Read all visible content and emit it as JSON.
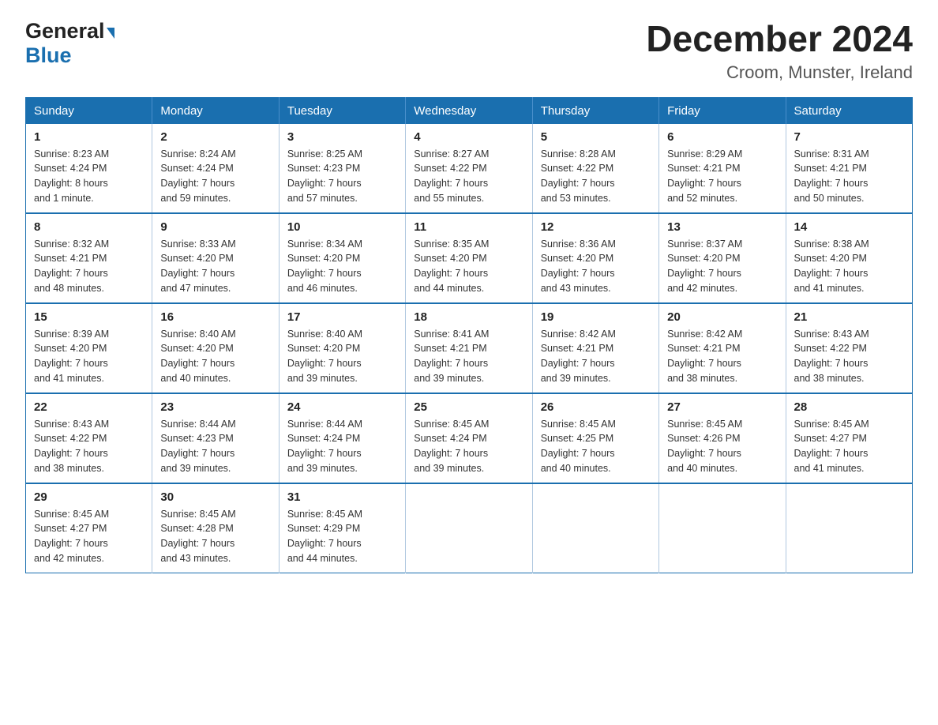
{
  "header": {
    "logo_general": "General",
    "logo_blue": "Blue",
    "title": "December 2024",
    "subtitle": "Croom, Munster, Ireland"
  },
  "days_of_week": [
    "Sunday",
    "Monday",
    "Tuesday",
    "Wednesday",
    "Thursday",
    "Friday",
    "Saturday"
  ],
  "weeks": [
    [
      {
        "day": "1",
        "sunrise": "8:23 AM",
        "sunset": "4:24 PM",
        "daylight": "8 hours and 1 minute."
      },
      {
        "day": "2",
        "sunrise": "8:24 AM",
        "sunset": "4:24 PM",
        "daylight": "7 hours and 59 minutes."
      },
      {
        "day": "3",
        "sunrise": "8:25 AM",
        "sunset": "4:23 PM",
        "daylight": "7 hours and 57 minutes."
      },
      {
        "day": "4",
        "sunrise": "8:27 AM",
        "sunset": "4:22 PM",
        "daylight": "7 hours and 55 minutes."
      },
      {
        "day": "5",
        "sunrise": "8:28 AM",
        "sunset": "4:22 PM",
        "daylight": "7 hours and 53 minutes."
      },
      {
        "day": "6",
        "sunrise": "8:29 AM",
        "sunset": "4:21 PM",
        "daylight": "7 hours and 52 minutes."
      },
      {
        "day": "7",
        "sunrise": "8:31 AM",
        "sunset": "4:21 PM",
        "daylight": "7 hours and 50 minutes."
      }
    ],
    [
      {
        "day": "8",
        "sunrise": "8:32 AM",
        "sunset": "4:21 PM",
        "daylight": "7 hours and 48 minutes."
      },
      {
        "day": "9",
        "sunrise": "8:33 AM",
        "sunset": "4:20 PM",
        "daylight": "7 hours and 47 minutes."
      },
      {
        "day": "10",
        "sunrise": "8:34 AM",
        "sunset": "4:20 PM",
        "daylight": "7 hours and 46 minutes."
      },
      {
        "day": "11",
        "sunrise": "8:35 AM",
        "sunset": "4:20 PM",
        "daylight": "7 hours and 44 minutes."
      },
      {
        "day": "12",
        "sunrise": "8:36 AM",
        "sunset": "4:20 PM",
        "daylight": "7 hours and 43 minutes."
      },
      {
        "day": "13",
        "sunrise": "8:37 AM",
        "sunset": "4:20 PM",
        "daylight": "7 hours and 42 minutes."
      },
      {
        "day": "14",
        "sunrise": "8:38 AM",
        "sunset": "4:20 PM",
        "daylight": "7 hours and 41 minutes."
      }
    ],
    [
      {
        "day": "15",
        "sunrise": "8:39 AM",
        "sunset": "4:20 PM",
        "daylight": "7 hours and 41 minutes."
      },
      {
        "day": "16",
        "sunrise": "8:40 AM",
        "sunset": "4:20 PM",
        "daylight": "7 hours and 40 minutes."
      },
      {
        "day": "17",
        "sunrise": "8:40 AM",
        "sunset": "4:20 PM",
        "daylight": "7 hours and 39 minutes."
      },
      {
        "day": "18",
        "sunrise": "8:41 AM",
        "sunset": "4:21 PM",
        "daylight": "7 hours and 39 minutes."
      },
      {
        "day": "19",
        "sunrise": "8:42 AM",
        "sunset": "4:21 PM",
        "daylight": "7 hours and 39 minutes."
      },
      {
        "day": "20",
        "sunrise": "8:42 AM",
        "sunset": "4:21 PM",
        "daylight": "7 hours and 38 minutes."
      },
      {
        "day": "21",
        "sunrise": "8:43 AM",
        "sunset": "4:22 PM",
        "daylight": "7 hours and 38 minutes."
      }
    ],
    [
      {
        "day": "22",
        "sunrise": "8:43 AM",
        "sunset": "4:22 PM",
        "daylight": "7 hours and 38 minutes."
      },
      {
        "day": "23",
        "sunrise": "8:44 AM",
        "sunset": "4:23 PM",
        "daylight": "7 hours and 39 minutes."
      },
      {
        "day": "24",
        "sunrise": "8:44 AM",
        "sunset": "4:24 PM",
        "daylight": "7 hours and 39 minutes."
      },
      {
        "day": "25",
        "sunrise": "8:45 AM",
        "sunset": "4:24 PM",
        "daylight": "7 hours and 39 minutes."
      },
      {
        "day": "26",
        "sunrise": "8:45 AM",
        "sunset": "4:25 PM",
        "daylight": "7 hours and 40 minutes."
      },
      {
        "day": "27",
        "sunrise": "8:45 AM",
        "sunset": "4:26 PM",
        "daylight": "7 hours and 40 minutes."
      },
      {
        "day": "28",
        "sunrise": "8:45 AM",
        "sunset": "4:27 PM",
        "daylight": "7 hours and 41 minutes."
      }
    ],
    [
      {
        "day": "29",
        "sunrise": "8:45 AM",
        "sunset": "4:27 PM",
        "daylight": "7 hours and 42 minutes."
      },
      {
        "day": "30",
        "sunrise": "8:45 AM",
        "sunset": "4:28 PM",
        "daylight": "7 hours and 43 minutes."
      },
      {
        "day": "31",
        "sunrise": "8:45 AM",
        "sunset": "4:29 PM",
        "daylight": "7 hours and 44 minutes."
      },
      null,
      null,
      null,
      null
    ]
  ],
  "labels": {
    "sunrise": "Sunrise:",
    "sunset": "Sunset:",
    "daylight": "Daylight:"
  }
}
